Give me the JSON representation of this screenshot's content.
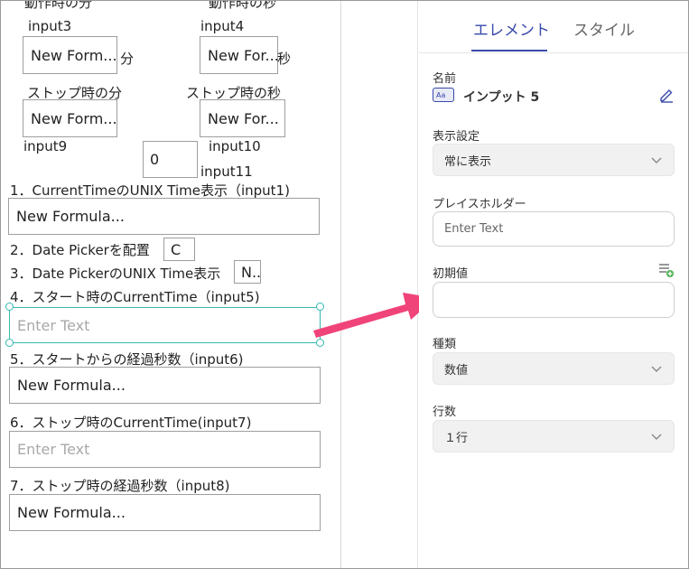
{
  "canvas": {
    "labels": {
      "dousa_fun": "動作時の分",
      "dousa_byo": "動作時の秒",
      "input3": "input3",
      "input4": "input4",
      "fun_unit": "分",
      "byo_unit": "秒",
      "stop_fun": "ストップ時の分",
      "stop_byo": "ストップ時の秒",
      "input9": "input9",
      "input10": "input10",
      "input11": "input11",
      "step1": "1．CurrentTimeのUNIX Time表示（input1)",
      "step2": "2．Date Pickerを配置",
      "step3": "3．Date PickerのUNIX Time表示",
      "step4": "4．スタート時のCurrentTime（input5)",
      "step5": "5．スタートからの経過秒数（input6)",
      "step6": "6．ストップ時のCurrentTime(input7)",
      "step7": "7．ストップ時の経過秒数（input8)"
    },
    "inputs": {
      "input3_value": "New Form...",
      "input4_value": "New For...",
      "input9_value": "New Form...",
      "input10_value": "New For...",
      "input11_value": "0",
      "input1_value": "New Formula...",
      "datepicker_value": "C",
      "step3_value": "N..",
      "input5_placeholder": "Enter Text",
      "input6_value": "New Formula...",
      "input7_placeholder": "Enter Text",
      "input8_value": "New Formula..."
    },
    "selection_color": "#36b8b0",
    "arrow_color": "#f0437a"
  },
  "panel": {
    "tabs": [
      {
        "label": "エレメント",
        "active": true
      },
      {
        "label": "スタイル",
        "active": false
      }
    ],
    "accent": "#3949ab",
    "name_label": "名前",
    "element_name": "インプット 5",
    "element_icon": "input-element-icon",
    "display_label": "表示設定",
    "display_value": "常に表示",
    "placeholder_label": "プレイスホルダー",
    "placeholder_value": "Enter Text",
    "initial_label": "初期値",
    "initial_value": "",
    "type_label": "種類",
    "type_value": "数値",
    "rows_label": "行数",
    "rows_value": "１行"
  }
}
